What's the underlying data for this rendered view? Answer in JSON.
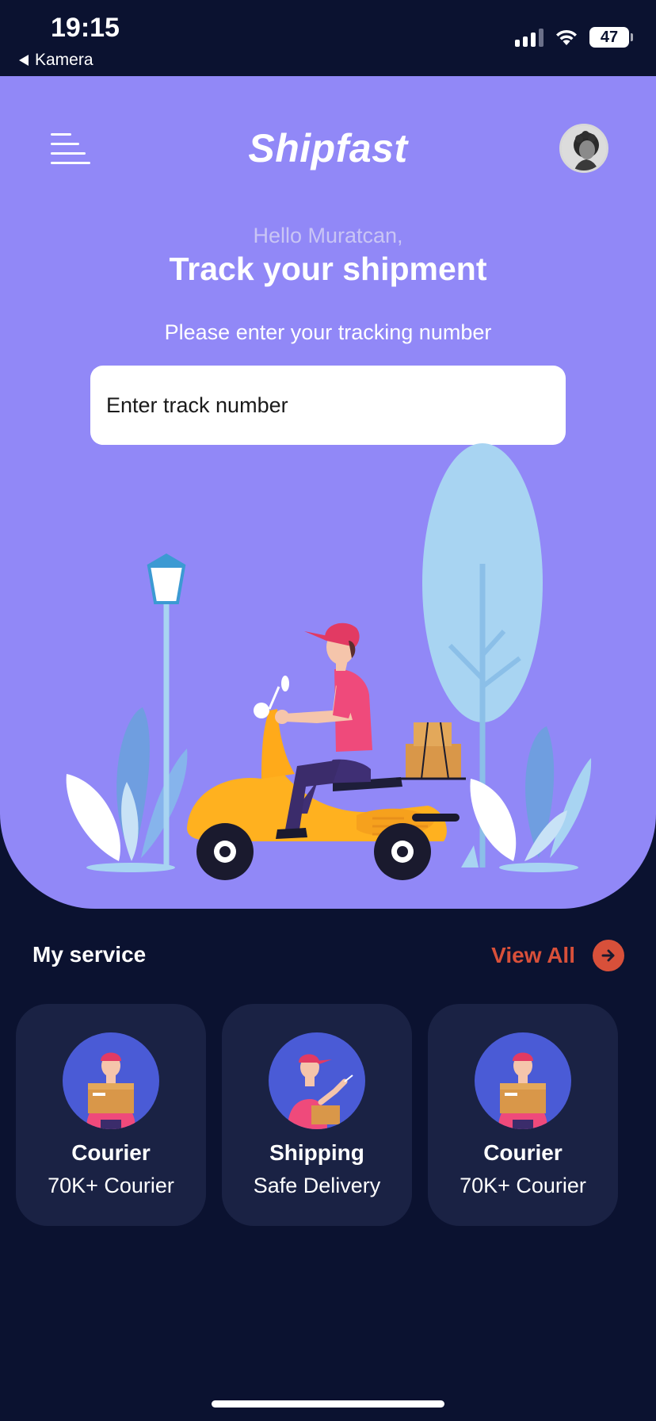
{
  "status_bar": {
    "time": "19:15",
    "back_app": "Kamera",
    "battery": "47"
  },
  "header": {
    "app_title": "Shipfast",
    "menu_icon": "hamburger-menu-icon",
    "avatar_icon": "user-avatar"
  },
  "hero": {
    "greeting": "Hello Muratcan,",
    "headline": "Track your shipment",
    "prompt": "Please enter your tracking number",
    "input_placeholder": "Enter track number",
    "illustration": "courier-on-scooter-illustration"
  },
  "services": {
    "title": "My service",
    "view_all": "View All",
    "view_all_icon": "arrow-right-icon",
    "items": [
      {
        "title": "Courier",
        "subtitle": "70K+ Courier",
        "icon": "courier-with-box"
      },
      {
        "title": "Shipping",
        "subtitle": "Safe Delivery",
        "icon": "courier-pointing"
      },
      {
        "title": "Courier",
        "subtitle": "70K+ Courier",
        "icon": "courier-with-box"
      }
    ]
  },
  "colors": {
    "background": "#0b1230",
    "hero": "#9188f7",
    "card": "#1a2244",
    "accent": "#d8503a",
    "card_avatar": "#4a5bd6"
  }
}
